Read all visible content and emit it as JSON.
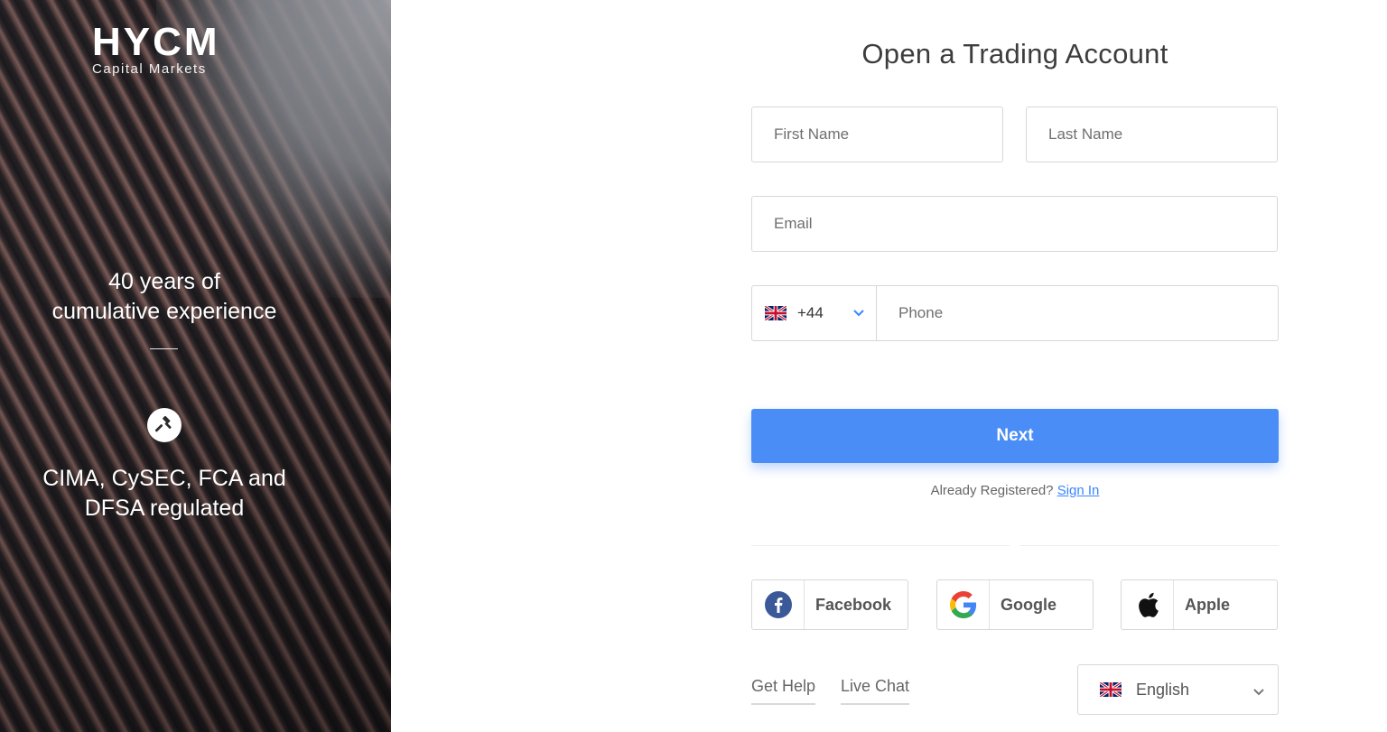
{
  "brand": {
    "logo_text": "HYCM",
    "logo_subtitle": "Capital Markets"
  },
  "promo": {
    "experience_line1": "40 years of",
    "experience_line2": "cumulative experience",
    "regulated_line1": "CIMA, CySEC, FCA and",
    "regulated_line2": "DFSA regulated",
    "gavel_icon": "gavel-icon"
  },
  "form": {
    "title": "Open a Trading Account",
    "first_name_placeholder": "First Name",
    "last_name_placeholder": "Last Name",
    "email_placeholder": "Email",
    "phone_prefix": "+44",
    "phone_country_flag": "uk-flag-icon",
    "phone_placeholder": "Phone",
    "next_label": "Next",
    "already_registered": "Already Registered?",
    "sign_in_label": "Sign In"
  },
  "social": {
    "facebook": "Facebook",
    "google": "Google",
    "apple": "Apple"
  },
  "footer": {
    "get_help": "Get Help",
    "live_chat": "Live Chat",
    "language": "English"
  },
  "colors": {
    "primary": "#4a8df6",
    "link": "#3a86ff",
    "facebook": "#3b5998"
  }
}
